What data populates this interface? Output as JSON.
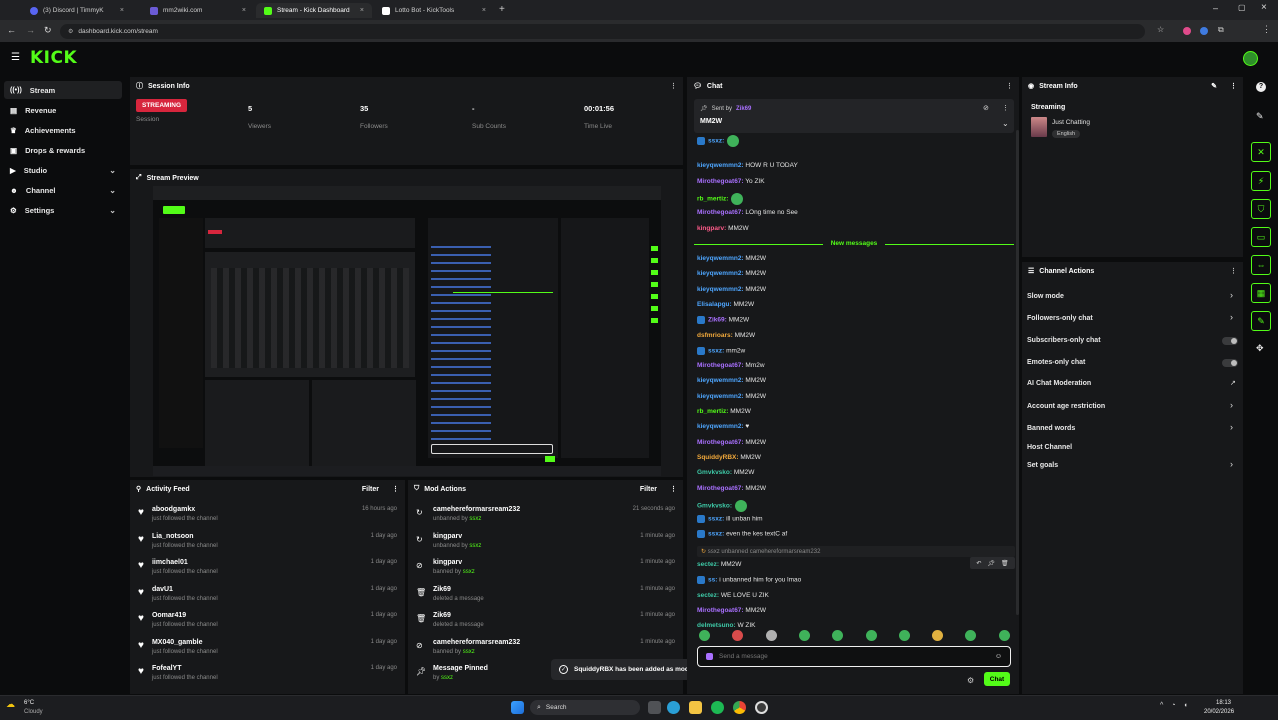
{
  "browser": {
    "tabs": [
      {
        "label": "(3) Discord | TimmyK",
        "active": false
      },
      {
        "label": "mm2wiki.com",
        "active": false
      },
      {
        "label": "Stream - Kick Dashboard",
        "active": true
      },
      {
        "label": "Lotto Bot - KickTools",
        "active": false
      }
    ],
    "new_tab": "+",
    "url": "dashboard.kick.com/stream"
  },
  "brand": {
    "logo": "KICK",
    "accent": "#53fc18"
  },
  "sidebar": {
    "items": [
      {
        "label": "Stream",
        "icon": "signal-icon",
        "active": true,
        "chevron": false
      },
      {
        "label": "Revenue",
        "icon": "wallet-icon",
        "active": false,
        "chevron": false
      },
      {
        "label": "Achievements",
        "icon": "trophy-icon",
        "active": false,
        "chevron": false
      },
      {
        "label": "Drops & rewards",
        "icon": "gift-icon",
        "active": false,
        "chevron": false
      },
      {
        "label": "Studio",
        "icon": "camera-icon",
        "active": false,
        "chevron": true
      },
      {
        "label": "Channel",
        "icon": "people-icon",
        "active": false,
        "chevron": true
      },
      {
        "label": "Settings",
        "icon": "gear-icon",
        "active": false,
        "chevron": true
      }
    ]
  },
  "session_info": {
    "title": "Session Info",
    "menu": "⋮",
    "stats": [
      {
        "value": "STREAMING",
        "label": "Session",
        "badge": true
      },
      {
        "value": "5",
        "label": "Viewers"
      },
      {
        "value": "35",
        "label": "Followers"
      },
      {
        "value": "-",
        "label": "Sub Counts"
      },
      {
        "value": "00:01:56",
        "label": "Time Live"
      }
    ]
  },
  "stream_preview": {
    "title": "Stream Preview"
  },
  "activity_feed": {
    "title": "Activity Feed",
    "filter": "Filter",
    "items": [
      {
        "name": "aboodgamkx",
        "sub": "just followed the channel",
        "time": "16 hours ago"
      },
      {
        "name": "Lia_notsoon",
        "sub": "just followed the channel",
        "time": "1 day ago"
      },
      {
        "name": "iimchael01",
        "sub": "just followed the channel",
        "time": "1 day ago"
      },
      {
        "name": "davU1",
        "sub": "just followed the channel",
        "time": "1 day ago"
      },
      {
        "name": "Oomar419",
        "sub": "just followed the channel",
        "time": "1 day ago"
      },
      {
        "name": "MX040_gamble",
        "sub": "just followed the channel",
        "time": "1 day ago"
      },
      {
        "name": "FofealYT",
        "sub": "just followed the channel",
        "time": "1 day ago"
      }
    ]
  },
  "mod_actions": {
    "title": "Mod Actions",
    "filter": "Filter",
    "items": [
      {
        "name": "camehereformarsream232",
        "sub": "unbanned by",
        "by": "ssxz",
        "time": "21 seconds ago",
        "icon": "unban-icon"
      },
      {
        "name": "kingparv",
        "sub": "unbanned by",
        "by": "ssxz",
        "time": "1 minute ago",
        "icon": "unban-icon"
      },
      {
        "name": "kingparv",
        "sub": "banned by",
        "by": "ssxz",
        "time": "1 minute ago",
        "icon": "ban-icon"
      },
      {
        "name": "Zik69",
        "sub": "deleted a message",
        "by": "",
        "time": "1 minute ago",
        "icon": "trash-icon"
      },
      {
        "name": "Zik69",
        "sub": "deleted a message",
        "by": "",
        "time": "1 minute ago",
        "icon": "trash-icon"
      },
      {
        "name": "camehereformarsream232",
        "sub": "banned by",
        "by": "ssxz",
        "time": "1 minute ago",
        "icon": "ban-icon"
      },
      {
        "name": "Message Pinned",
        "sub": "by",
        "by": "ssxz",
        "time": "1 minute ago",
        "icon": "pin-icon"
      }
    ]
  },
  "toast": {
    "text": "SquiddyRBX has been added as moderator"
  },
  "chat": {
    "title": "Chat",
    "pinned": {
      "sent_by_label": "Sent by",
      "sender": "Zik69",
      "message": "MM2W"
    },
    "new_messages_label": "New messages",
    "messages_top": [
      {
        "user": "ssxz:",
        "text": "",
        "color": "blue",
        "badge": true,
        "emote": true
      },
      {
        "user": "kieyqwemmn2:",
        "text": "HOW R U TODAY",
        "color": "blue"
      },
      {
        "user": "Mirothegoat67:",
        "text": "Yo ZIK",
        "color": "purple"
      },
      {
        "user": "rb_mertiz:",
        "text": "",
        "color": "green",
        "emote": true
      },
      {
        "user": "Mirothegoat67:",
        "text": "LOng time no See",
        "color": "purple"
      },
      {
        "user": "kingparv:",
        "text": "MM2W",
        "color": "pink"
      }
    ],
    "messages_bottom": [
      {
        "user": "kieyqwemmn2:",
        "text": "MM2W",
        "color": "blue"
      },
      {
        "user": "kieyqwemmn2:",
        "text": "MM2W",
        "color": "blue"
      },
      {
        "user": "kieyqwemmn2:",
        "text": "MM2W",
        "color": "blue"
      },
      {
        "user": "Elisalapgu:",
        "text": "MM2W",
        "color": "blue"
      },
      {
        "user": "Zik69:",
        "text": "MM2W",
        "color": "purple",
        "badge": true
      },
      {
        "user": "dsfmrioars:",
        "text": "MM2W",
        "color": "orange"
      },
      {
        "user": "ssxz:",
        "text": "mm2w",
        "color": "blue",
        "badge": true
      },
      {
        "user": "Mirothegoat67:",
        "text": "Mm2w",
        "color": "purple"
      },
      {
        "user": "kieyqwemmn2:",
        "text": "MM2W",
        "color": "blue"
      },
      {
        "user": "kieyqwemmn2:",
        "text": "MM2W",
        "color": "blue"
      },
      {
        "user": "rb_mertiz:",
        "text": "MM2W",
        "color": "green"
      },
      {
        "user": "kieyqwemmn2:",
        "text": "♥",
        "color": "blue"
      },
      {
        "user": "Mirothegoat67:",
        "text": "MM2W",
        "color": "purple"
      },
      {
        "user": "SquiddyRBX:",
        "text": "MM2W",
        "color": "orange"
      },
      {
        "user": "Gmvkvsko:",
        "text": "MM2W",
        "color": "teal"
      },
      {
        "user": "Mirothegoat67:",
        "text": "MM2W",
        "color": "purple"
      },
      {
        "user": "Gmvkvsko:",
        "text": "",
        "color": "teal",
        "emote": true
      },
      {
        "user": "ssxz:",
        "text": "ill unban him",
        "color": "blue",
        "badge": true
      },
      {
        "user": "ssxz:",
        "text": "even the kes textC af",
        "color": "blue",
        "badge": true
      },
      {
        "user": "ssxz",
        "text": "unbanned camehereformarsream232",
        "color": "system"
      },
      {
        "user": "sectez:",
        "text": "MM2W",
        "color": "teal"
      },
      {
        "user": "ss:",
        "text": "i unbanned him for you lmao",
        "color": "blue",
        "badge": true
      },
      {
        "user": "sectez:",
        "text": "WE LOVE U ZIK",
        "color": "teal"
      },
      {
        "user": "Mirothegoat67:",
        "text": "MM2W",
        "color": "purple"
      },
      {
        "user": "delmetsuno:",
        "text": "W ZIK",
        "color": "teal"
      }
    ],
    "input_placeholder": "Send a message",
    "send_label": "Chat"
  },
  "stream_info": {
    "title": "Stream Info",
    "status": "Streaming",
    "category": "Just Chatting",
    "language": "English"
  },
  "channel_actions": {
    "title": "Channel Actions",
    "items": [
      {
        "label": "Slow mode",
        "control": "chevron"
      },
      {
        "label": "Followers-only chat",
        "control": "chevron"
      },
      {
        "label": "Subscribers-only chat",
        "control": "toggle"
      },
      {
        "label": "Emotes-only chat",
        "control": "toggle"
      },
      {
        "label": "AI Chat Moderation",
        "control": "external"
      },
      {
        "label": "Account age restriction",
        "control": "chevron"
      },
      {
        "label": "Banned words",
        "control": "chevron"
      },
      {
        "label": "Host Channel",
        "control": "none"
      },
      {
        "label": "Set goals",
        "control": "chevron"
      }
    ]
  },
  "taskbar": {
    "weather_temp": "6°C",
    "weather_desc": "Cloudy",
    "search_label": "Search",
    "time": "18:13",
    "date": "20/02/2026"
  }
}
